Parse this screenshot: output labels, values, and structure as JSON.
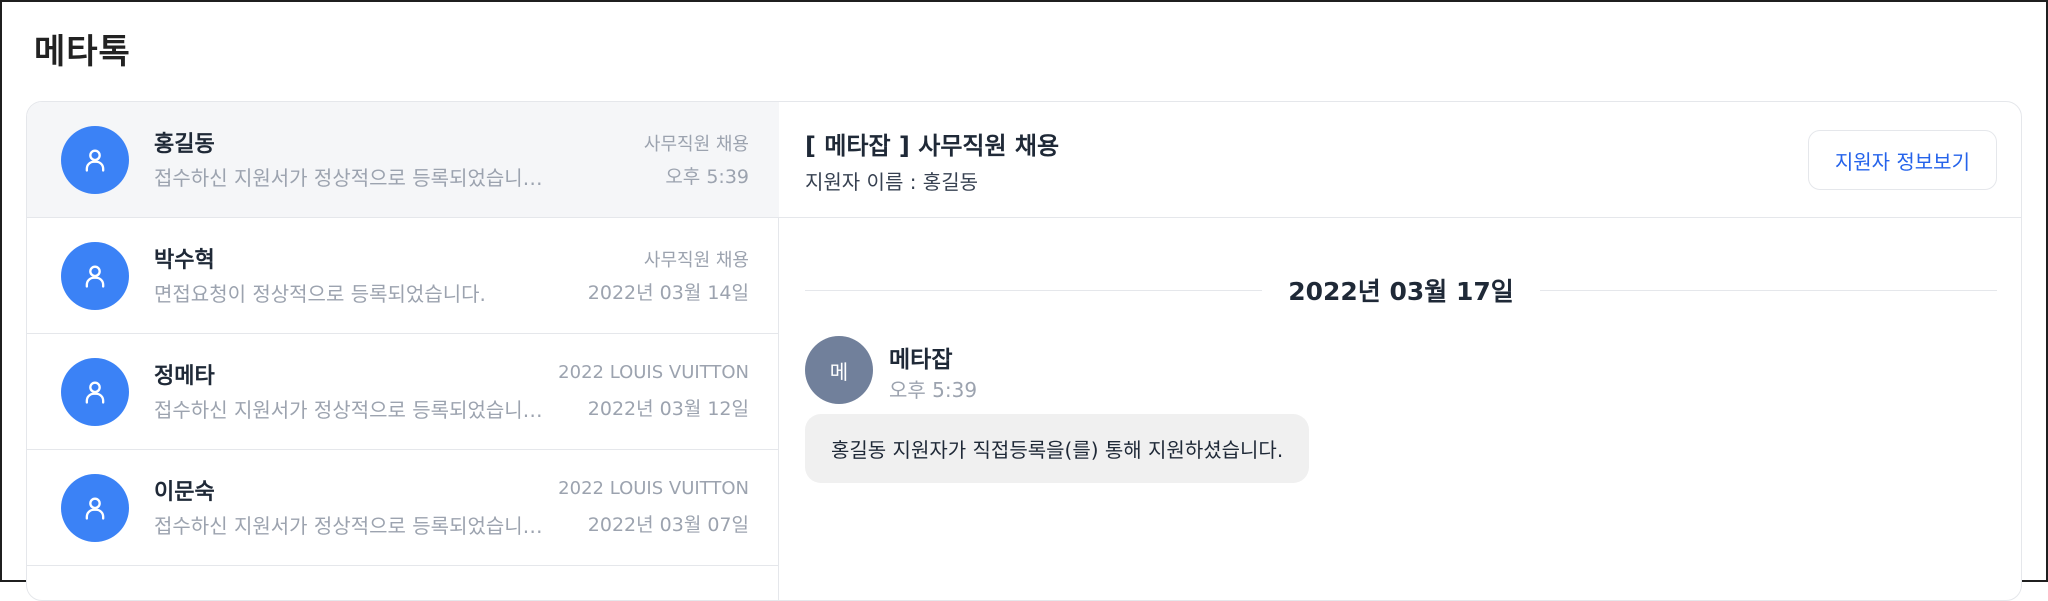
{
  "app_title": "메타톡",
  "conversations": [
    {
      "name": "홍길동",
      "preview": "접수하신 지원서가 정상적으로 등록되었습니다.",
      "job": "사무직원 채용",
      "time": "오후 5:39",
      "active": true
    },
    {
      "name": "박수혁",
      "preview": "면접요청이 정상적으로 등록되었습니다.",
      "job": "사무직원 채용",
      "time": "2022년 03월 14일",
      "active": false
    },
    {
      "name": "정메타",
      "preview": "접수하신 지원서가 정상적으로 등록되었습니다.",
      "job": "2022 LOUIS VUITTON",
      "time": "2022년 03월 12일",
      "active": false
    },
    {
      "name": "이문숙",
      "preview": "접수하신 지원서가 정상적으로 등록되었습니다.",
      "job": "2022 LOUIS VUITTON",
      "time": "2022년 03월 07일",
      "active": false
    }
  ],
  "chat": {
    "title": "[ 메타잡 ] 사무직원 채용",
    "subtitle": "지원자 이름 : 홍길동",
    "info_button": "지원자 정보보기",
    "date": "2022년 03월 17일",
    "message": {
      "avatar_text": "메",
      "sender": "메타잡",
      "time": "오후 5:39",
      "text": "홍길동 지원자가 직접등록을(를) 통해 지원하셨습니다."
    }
  },
  "colors": {
    "accent": "#3b82f6",
    "link": "#2563eb",
    "sender_avatar": "#71809b",
    "bubble": "#f0f0f0"
  }
}
